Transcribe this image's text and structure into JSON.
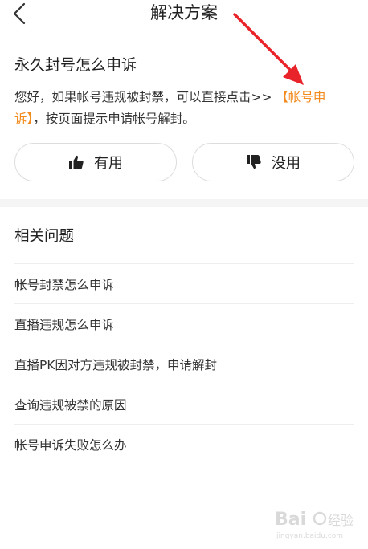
{
  "header": {
    "title": "解决方案",
    "back_icon": "chevron-left-icon"
  },
  "answer": {
    "question": "永久封号怎么申诉",
    "text_before_link": "您好，如果帐号违规被封禁，可以直接点击>> ",
    "link_text": "【帐号申诉】",
    "text_after_link": "，按页面提示申请帐号解封。",
    "link_color": "#f28a1c"
  },
  "feedback": {
    "useful_label": "有用",
    "useful_icon": "thumbs-up-icon",
    "useless_label": "没用",
    "useless_icon": "thumbs-down-icon"
  },
  "related": {
    "title": "相关问题",
    "items": [
      "帐号封禁怎么申诉",
      "直播违规怎么申诉",
      "直播PK因对方违规被封禁，申请解封",
      "查询违规被禁的原因",
      "帐号申诉失败怎么办"
    ]
  },
  "annotation": {
    "arrow_color": "#e8232a"
  },
  "watermark": {
    "brand": "Bai",
    "brand_suffix": "经验",
    "url": "jingyan.baidu.com"
  }
}
